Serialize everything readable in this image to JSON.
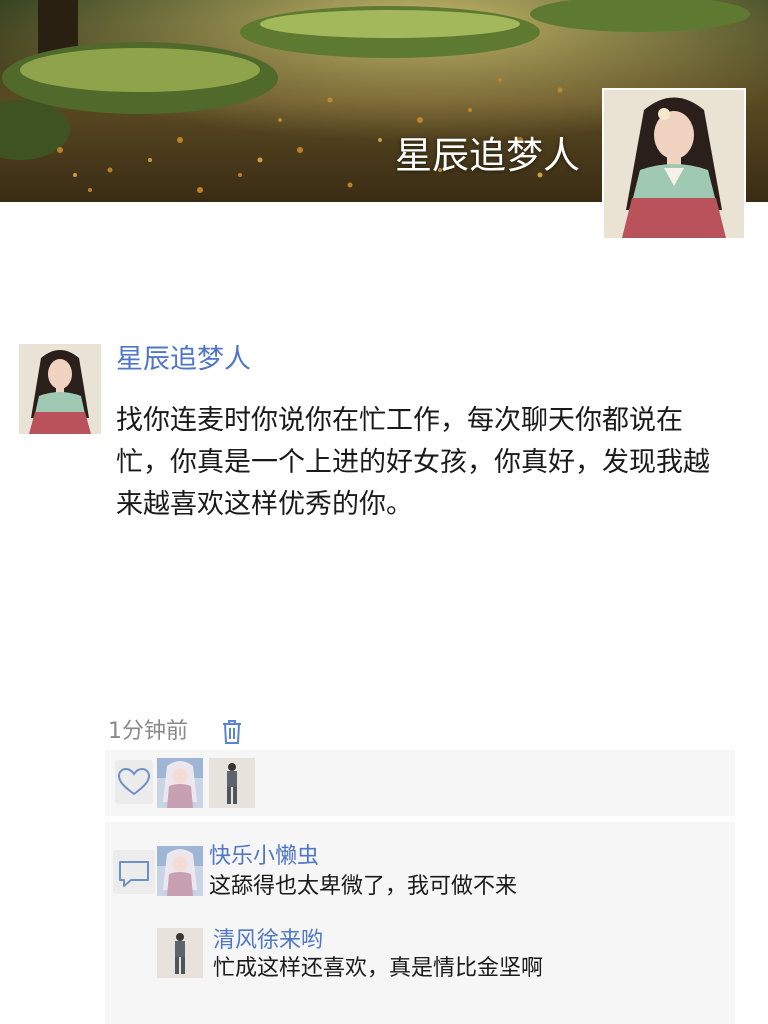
{
  "profile": {
    "cover_name": "星辰追梦人",
    "cover_image": "forest-path-autumn-leaves-photo",
    "avatar_image": "woman-in-hanbok-photo"
  },
  "post": {
    "author": "星辰追梦人",
    "text": "找你连麦时你说你在忙工作，每次聊天你都说在忙，你真是一个上进的好女孩，你真好，发现我越来越喜欢这样优秀的你。",
    "time": "1分钟前",
    "delete_icon": "trash-icon"
  },
  "likes": {
    "icon": "heart-outline-icon",
    "avatars": [
      "anime-girl-avatar",
      "standing-person-avatar"
    ]
  },
  "comments": {
    "icon": "comment-bubble-icon",
    "items": [
      {
        "name": "快乐小懒虫",
        "text": "这舔得也太卑微了，我可做不来",
        "avatar": "anime-girl-avatar"
      },
      {
        "name": "清风徐来哟",
        "text": "忙成这样还喜欢，真是情比金坚啊",
        "avatar": "standing-person-avatar"
      }
    ]
  },
  "colors": {
    "link_blue": "#4f76c7",
    "text": "#1a1a1a",
    "muted": "#8a8a8a",
    "panel_bg": "#f6f6f6"
  }
}
